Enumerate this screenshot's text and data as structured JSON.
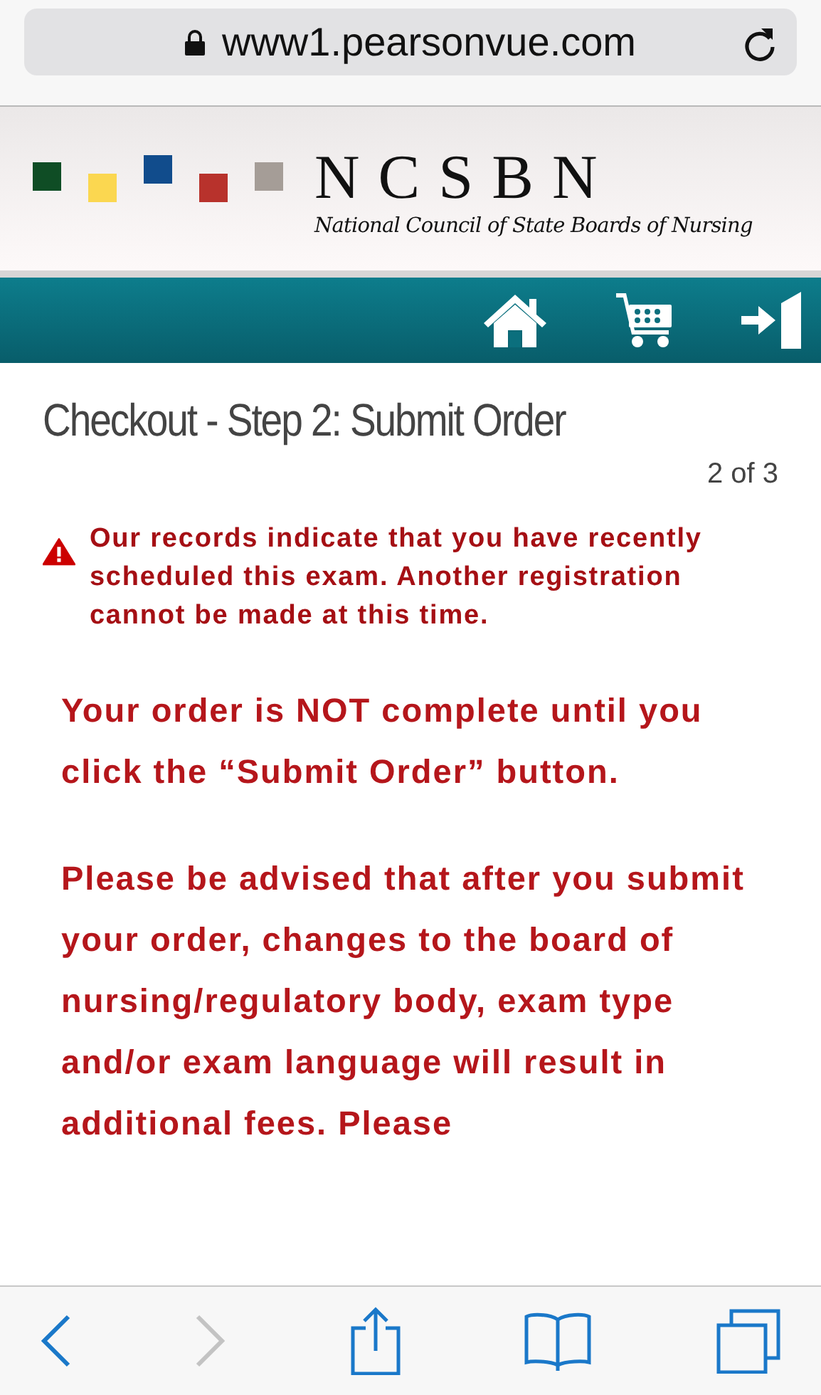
{
  "browser": {
    "url": "www1.pearsonvue.com",
    "secure": true
  },
  "logo": {
    "squares": [
      {
        "color": "#0f4d25"
      },
      {
        "color": "#fbd750"
      },
      {
        "color": "#114c8c"
      },
      {
        "color": "#b8322c"
      },
      {
        "color": "#a59d97"
      }
    ],
    "title": "NCSBN",
    "subtitle": "National Council of State Boards of Nursing"
  },
  "page": {
    "title": "Checkout - Step 2: Submit Order",
    "step": "2 of 3",
    "alert": "Our records indicate that you have recently scheduled this exam. Another registration cannot be made at this time.",
    "paragraphs": [
      "Your order is NOT complete until you click the “Submit Order” button.",
      "Please be advised that after you submit your order, changes to the board of nursing/regulatory body, exam type and/or exam language will result in additional fees. Please"
    ]
  },
  "toolbar": {
    "back": {
      "disabled": false
    },
    "forward": {
      "disabled": true
    }
  }
}
